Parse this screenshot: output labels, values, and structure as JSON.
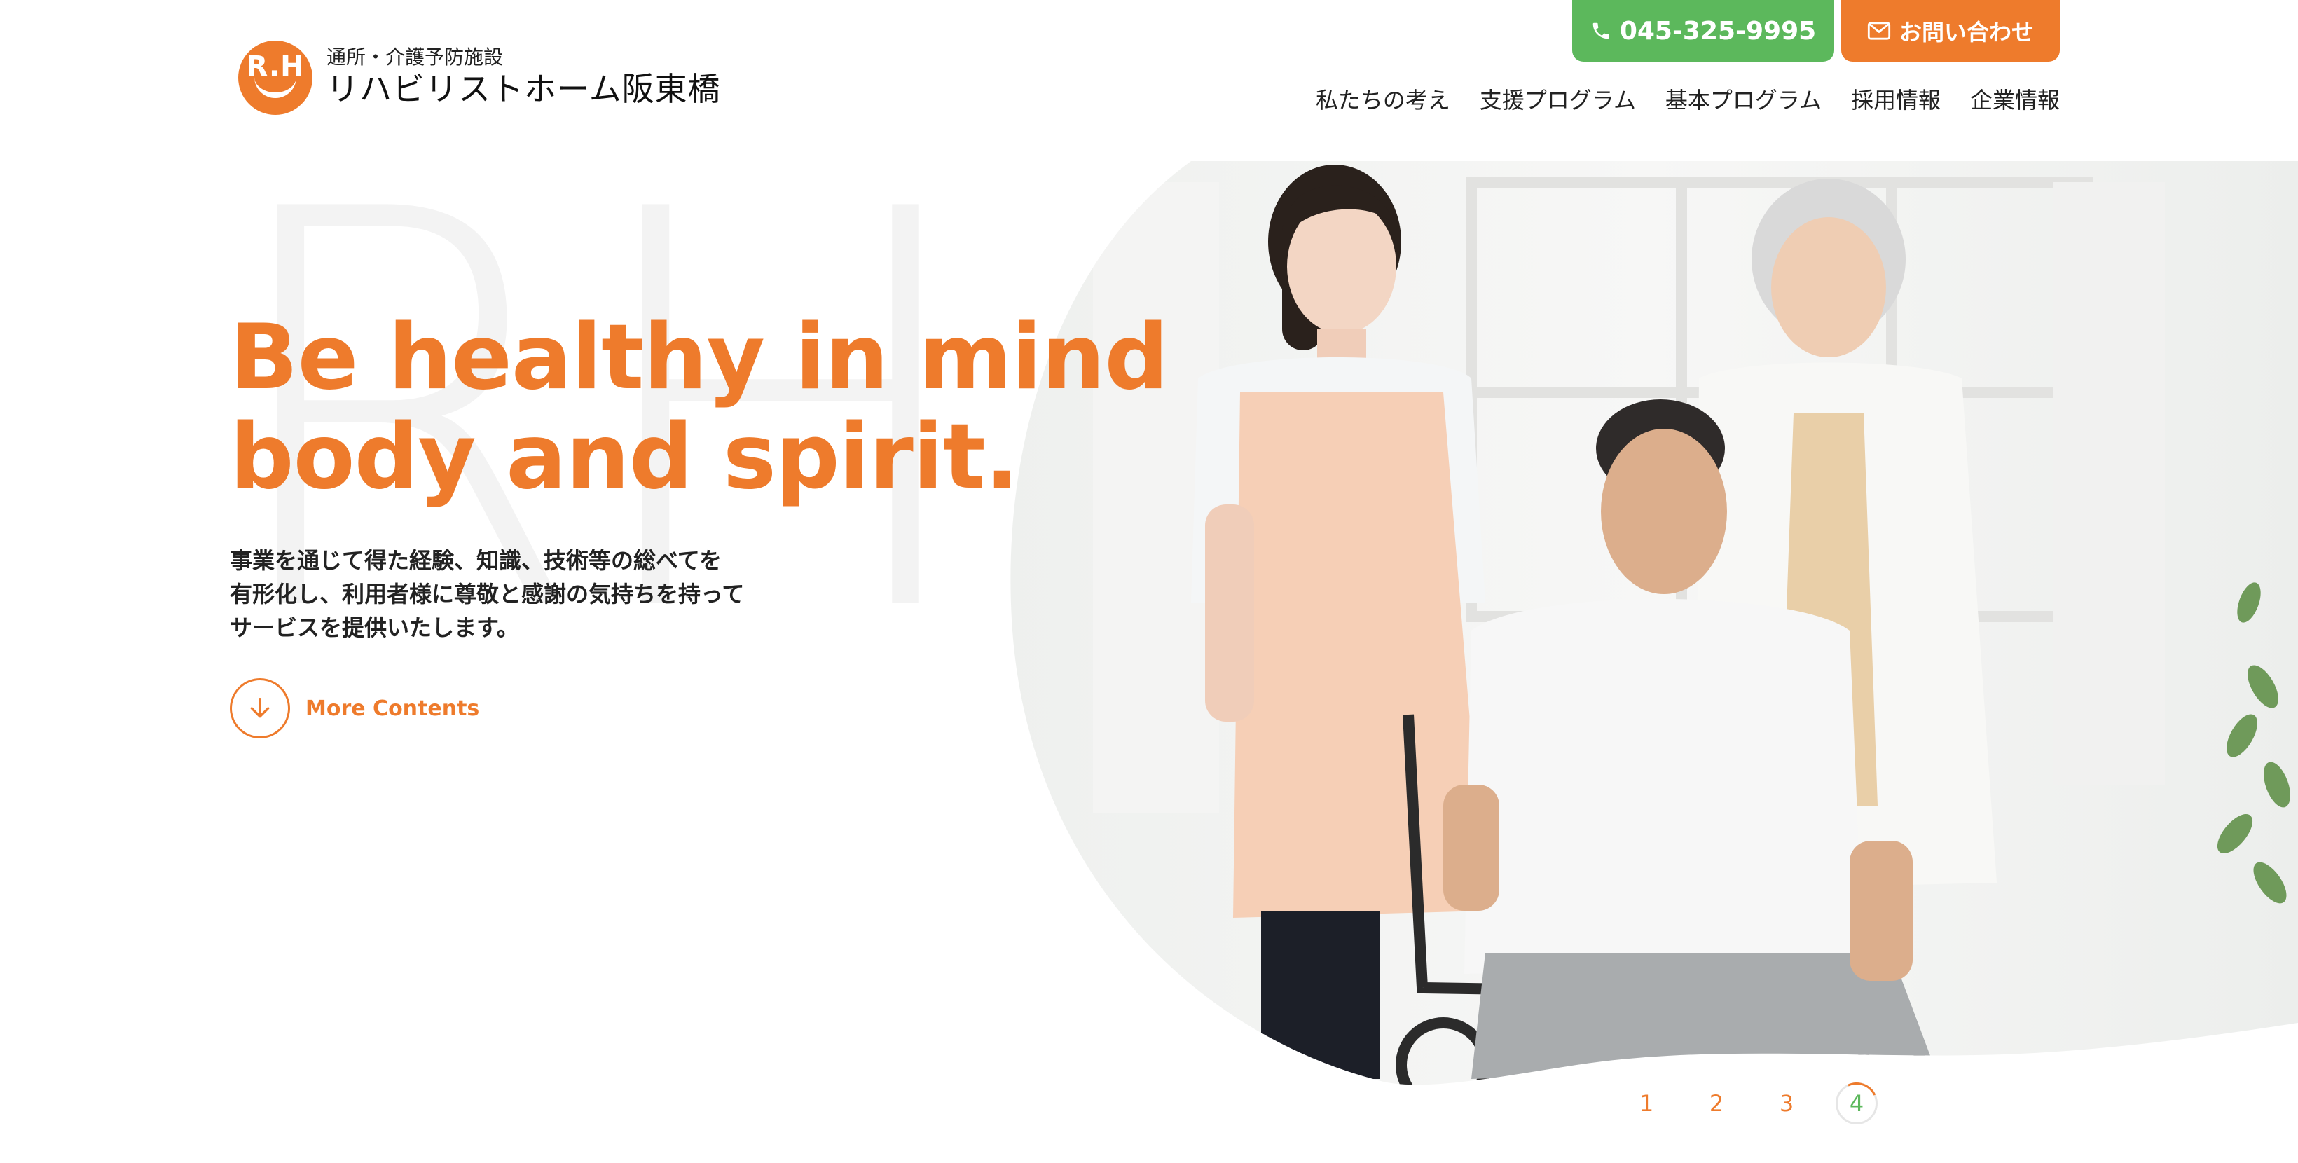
{
  "header": {
    "logo": {
      "mark_text": "R.H",
      "subtitle": "通所・介護予防施設",
      "name": "リハビリストホーム阪東橋"
    },
    "phone_label": "045-325-9995",
    "contact_label": "お問い合わせ",
    "nav": [
      {
        "label": "私たちの考え"
      },
      {
        "label": "支援プログラム"
      },
      {
        "label": "基本プログラム"
      },
      {
        "label": "採用情報"
      },
      {
        "label": "企業情報"
      }
    ]
  },
  "hero": {
    "watermark": "RH",
    "headline_line1": "Be healthy in mind",
    "headline_line2": "body and spirit.",
    "desc_line1": "事業を通じて得た経験、知識、技術等の総べてを",
    "desc_line2": "有形化し、利用者様に尊敬と感謝の気持ちを持って",
    "desc_line3": "サービスを提供いたします。",
    "more_label": "More Contents"
  },
  "pagination": {
    "pages": [
      "1",
      "2",
      "3",
      "4"
    ],
    "active": "4"
  },
  "colors": {
    "accent_orange": "#ee7b2c",
    "accent_green": "#5cb85c"
  },
  "icons": {
    "phone": "phone-icon",
    "mail": "mail-icon",
    "arrow": "arrow-down-icon"
  }
}
